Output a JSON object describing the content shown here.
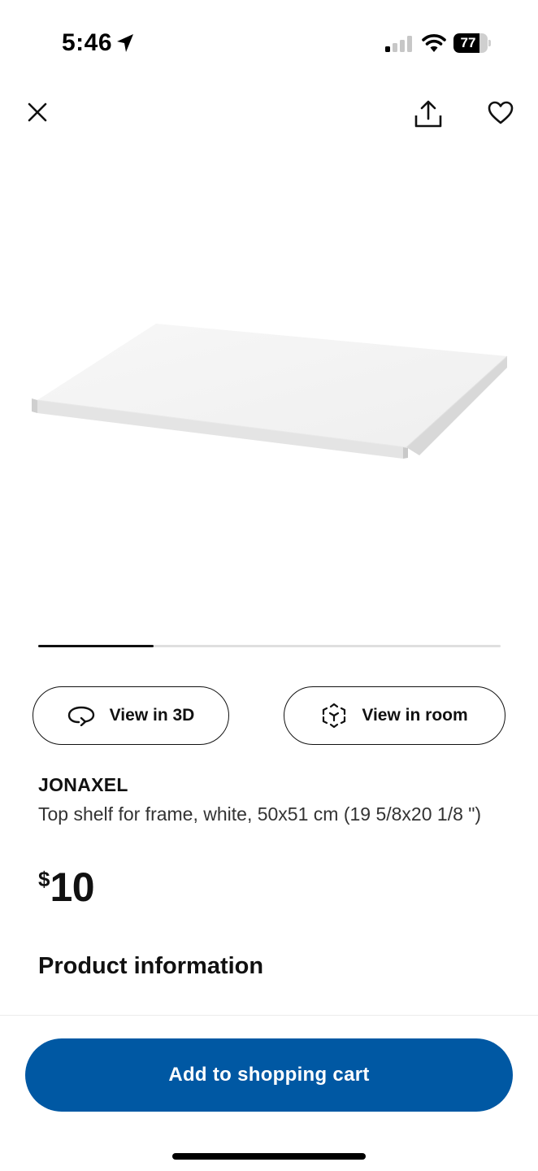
{
  "status_bar": {
    "time": "5:46",
    "battery_level": "77",
    "battery_fraction": 0.77
  },
  "nav": {
    "close_icon": "close-icon",
    "share_icon": "share-icon",
    "favorite_icon": "heart-icon"
  },
  "gallery": {
    "progress_fraction": 0.25
  },
  "actions": {
    "view_3d_label": "View in 3D",
    "view_room_label": "View in room"
  },
  "product": {
    "name": "JONAXEL",
    "description": "Top shelf for frame, white, 50x51 cm (19 5/8x20 1/8 \")",
    "price_currency": "$",
    "price_value": "10"
  },
  "sections": {
    "product_information": "Product information"
  },
  "cart": {
    "button_label": "Add to shopping cart",
    "color": "#0058a3"
  }
}
